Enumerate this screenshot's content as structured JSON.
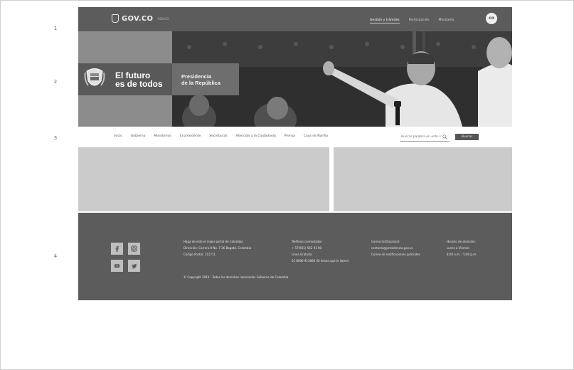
{
  "rows": [
    "1",
    "2",
    "3",
    "4"
  ],
  "gov_header": {
    "logo_text": "GOV.CO",
    "logo_sub": "GOV.CO",
    "nav": [
      "Gestión y trámites",
      "Participación",
      "Ministerio"
    ],
    "badge": "co"
  },
  "hero": {
    "slogan_line1": "El futuro",
    "slogan_line2": "es de todos",
    "presidency_line1": "Presidencia",
    "presidency_line2": "de la República"
  },
  "main_nav": {
    "items": [
      "Inicio",
      "Gobierno",
      "Ministerios",
      "El presidente",
      "Secretarias",
      "Atención a la Ciudadanía",
      "Prensa",
      "Casa de Nariño"
    ],
    "search_placeholder": "Buscar palabra en este sitio",
    "search_button": "Buscar"
  },
  "footer": {
    "social_icons": [
      "facebook-icon",
      "instagram-icon",
      "youtube-icon",
      "twitter-icon"
    ],
    "col1": [
      "Haga de este el mejor portal de Colombia",
      "Dirección: Carrera 8 No. 7-26 Bogotá, Colombia",
      "Código Postal: 111711"
    ],
    "col2": [
      "Teléfono conmutador:",
      "+ 57(601) 562 93 00",
      "Línea Gratuita",
      "01 8000 913666 (Si desea que le llame)"
    ],
    "col3": [
      "Correo Institucional:",
      "contacto@presidencia.gov.co",
      "Correo de notificaciones judiciales"
    ],
    "col4": [
      "Horario de atención:",
      "Lunes a Viernes",
      "8:00 a.m. - 5:00 p.m."
    ],
    "copyright": "© Copyright 2019 - Todos los derechos reservados Gobierno de Colombia"
  }
}
